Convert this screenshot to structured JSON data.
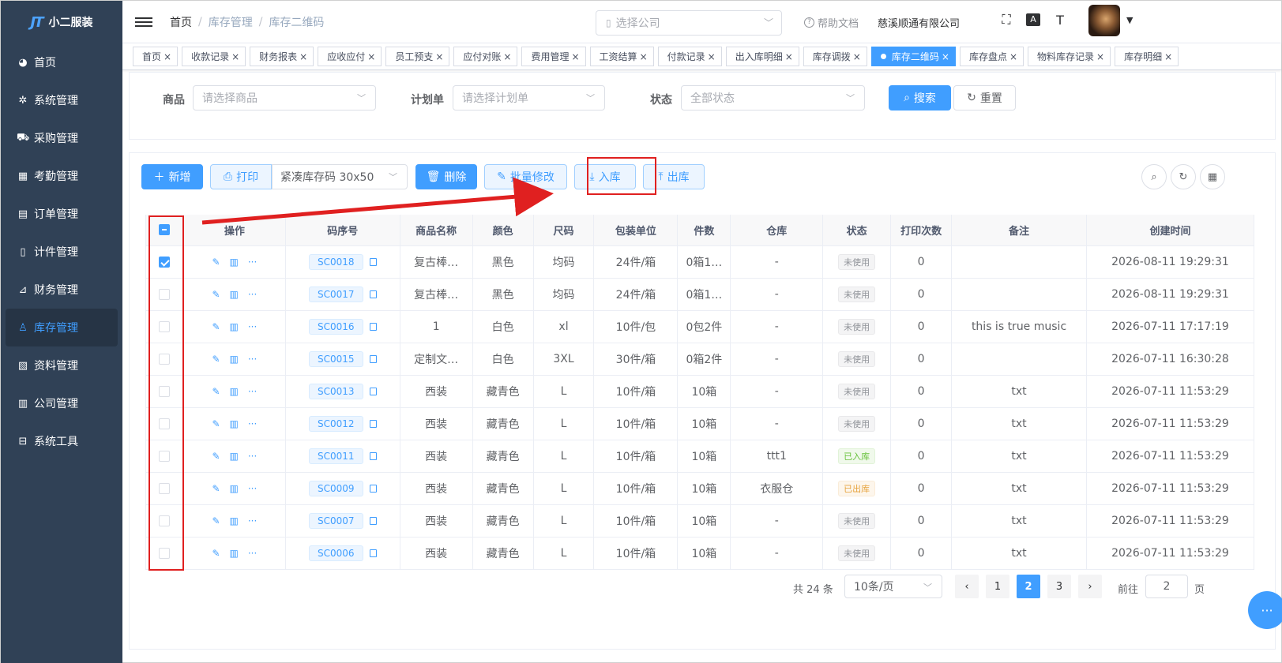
{
  "app": {
    "name": "小二服装",
    "logo_mark": "JT"
  },
  "sidebar": {
    "items": [
      {
        "label": "首页",
        "icon": "dashboard-icon"
      },
      {
        "label": "系统管理",
        "icon": "gear-icon"
      },
      {
        "label": "采购管理",
        "icon": "cart-icon"
      },
      {
        "label": "考勤管理",
        "icon": "grid-icon"
      },
      {
        "label": "订单管理",
        "icon": "order-icon"
      },
      {
        "label": "计件管理",
        "icon": "book-icon"
      },
      {
        "label": "财务管理",
        "icon": "chart-icon"
      },
      {
        "label": "库存管理",
        "icon": "user-icon",
        "active": true
      },
      {
        "label": "资料管理",
        "icon": "doc-icon"
      },
      {
        "label": "公司管理",
        "icon": "bar-chart-icon"
      },
      {
        "label": "系统工具",
        "icon": "toolbox-icon"
      }
    ]
  },
  "header": {
    "breadcrumb": [
      "首页",
      "库存管理",
      "库存二维码"
    ],
    "company_placeholder": "选择公司",
    "help": "帮助文档",
    "company_name": "慈溪顺通有限公司"
  },
  "tags": [
    {
      "label": "首页"
    },
    {
      "label": "收款记录"
    },
    {
      "label": "财务报表"
    },
    {
      "label": "应收应付"
    },
    {
      "label": "员工预支"
    },
    {
      "label": "应付对账"
    },
    {
      "label": "费用管理"
    },
    {
      "label": "工资结算"
    },
    {
      "label": "付款记录"
    },
    {
      "label": "出入库明细"
    },
    {
      "label": "库存调拨"
    },
    {
      "label": "库存二维码",
      "active": true
    },
    {
      "label": "库存盘点"
    },
    {
      "label": "物料库存记录"
    },
    {
      "label": "库存明细"
    }
  ],
  "search": {
    "goods_label": "商品",
    "goods_placeholder": "请选择商品",
    "plan_label": "计划单",
    "plan_placeholder": "请选择计划单",
    "status_label": "状态",
    "status_placeholder": "全部状态",
    "search_btn": "搜索",
    "reset_btn": "重置"
  },
  "toolbar": {
    "add": "新增",
    "print": "打印",
    "template": "紧凑库存码 30x50",
    "delete": "删除",
    "batch_edit": "批量修改",
    "stock_in": "入库",
    "stock_out": "出库"
  },
  "table": {
    "headers": [
      "操作",
      "码序号",
      "商品名称",
      "颜色",
      "尺码",
      "包装单位",
      "件数",
      "仓库",
      "状态",
      "打印次数",
      "备注",
      "创建时间"
    ],
    "rows": [
      {
        "checked": true,
        "code": "SC0018",
        "name": "复古棒…",
        "color": "黑色",
        "size": "均码",
        "unit": "24件/箱",
        "qty": "0箱1…",
        "warehouse": "-",
        "status": "未使用",
        "status_type": "unused",
        "prints": "0",
        "remark": "",
        "created": "2026-08-11 19:29:31"
      },
      {
        "checked": false,
        "code": "SC0017",
        "name": "复古棒…",
        "color": "黑色",
        "size": "均码",
        "unit": "24件/箱",
        "qty": "0箱1…",
        "warehouse": "-",
        "status": "未使用",
        "status_type": "unused",
        "prints": "0",
        "remark": "",
        "created": "2026-08-11 19:29:31"
      },
      {
        "checked": false,
        "code": "SC0016",
        "name": "1",
        "color": "白色",
        "size": "xl",
        "unit": "10件/包",
        "qty": "0包2件",
        "warehouse": "-",
        "status": "未使用",
        "status_type": "unused",
        "prints": "0",
        "remark": "this is true music",
        "created": "2026-07-11 17:17:19"
      },
      {
        "checked": false,
        "code": "SC0015",
        "name": "定制文…",
        "color": "白色",
        "size": "3XL",
        "unit": "30件/箱",
        "qty": "0箱2件",
        "warehouse": "-",
        "status": "未使用",
        "status_type": "unused",
        "prints": "0",
        "remark": "",
        "created": "2026-07-11 16:30:28"
      },
      {
        "checked": false,
        "code": "SC0013",
        "name": "西装",
        "color": "藏青色",
        "size": "L",
        "unit": "10件/箱",
        "qty": "10箱",
        "warehouse": "-",
        "status": "未使用",
        "status_type": "unused",
        "prints": "0",
        "remark": "txt",
        "created": "2026-07-11 11:53:29"
      },
      {
        "checked": false,
        "code": "SC0012",
        "name": "西装",
        "color": "藏青色",
        "size": "L",
        "unit": "10件/箱",
        "qty": "10箱",
        "warehouse": "-",
        "status": "未使用",
        "status_type": "unused",
        "prints": "0",
        "remark": "txt",
        "created": "2026-07-11 11:53:29"
      },
      {
        "checked": false,
        "code": "SC0011",
        "name": "西装",
        "color": "藏青色",
        "size": "L",
        "unit": "10件/箱",
        "qty": "10箱",
        "warehouse": "ttt1",
        "status": "已入库",
        "status_type": "in",
        "prints": "0",
        "remark": "txt",
        "created": "2026-07-11 11:53:29"
      },
      {
        "checked": false,
        "code": "SC0009",
        "name": "西装",
        "color": "藏青色",
        "size": "L",
        "unit": "10件/箱",
        "qty": "10箱",
        "warehouse": "衣服仓",
        "status": "已出库",
        "status_type": "out",
        "prints": "0",
        "remark": "txt",
        "created": "2026-07-11 11:53:29"
      },
      {
        "checked": false,
        "code": "SC0007",
        "name": "西装",
        "color": "藏青色",
        "size": "L",
        "unit": "10件/箱",
        "qty": "10箱",
        "warehouse": "-",
        "status": "未使用",
        "status_type": "unused",
        "prints": "0",
        "remark": "txt",
        "created": "2026-07-11 11:53:29"
      },
      {
        "checked": false,
        "code": "SC0006",
        "name": "西装",
        "color": "藏青色",
        "size": "L",
        "unit": "10件/箱",
        "qty": "10箱",
        "warehouse": "-",
        "status": "未使用",
        "status_type": "unused",
        "prints": "0",
        "remark": "txt",
        "created": "2026-07-11 11:53:29"
      }
    ]
  },
  "pagination": {
    "total": "共 24 条",
    "page_size": "10条/页",
    "pages": [
      "1",
      "2",
      "3"
    ],
    "current": "2",
    "goto_label": "前往",
    "goto_value": "2",
    "page_suffix": "页"
  },
  "colors": {
    "primary": "#409eff",
    "sidebar": "#304156",
    "annotation": "#e02020"
  }
}
